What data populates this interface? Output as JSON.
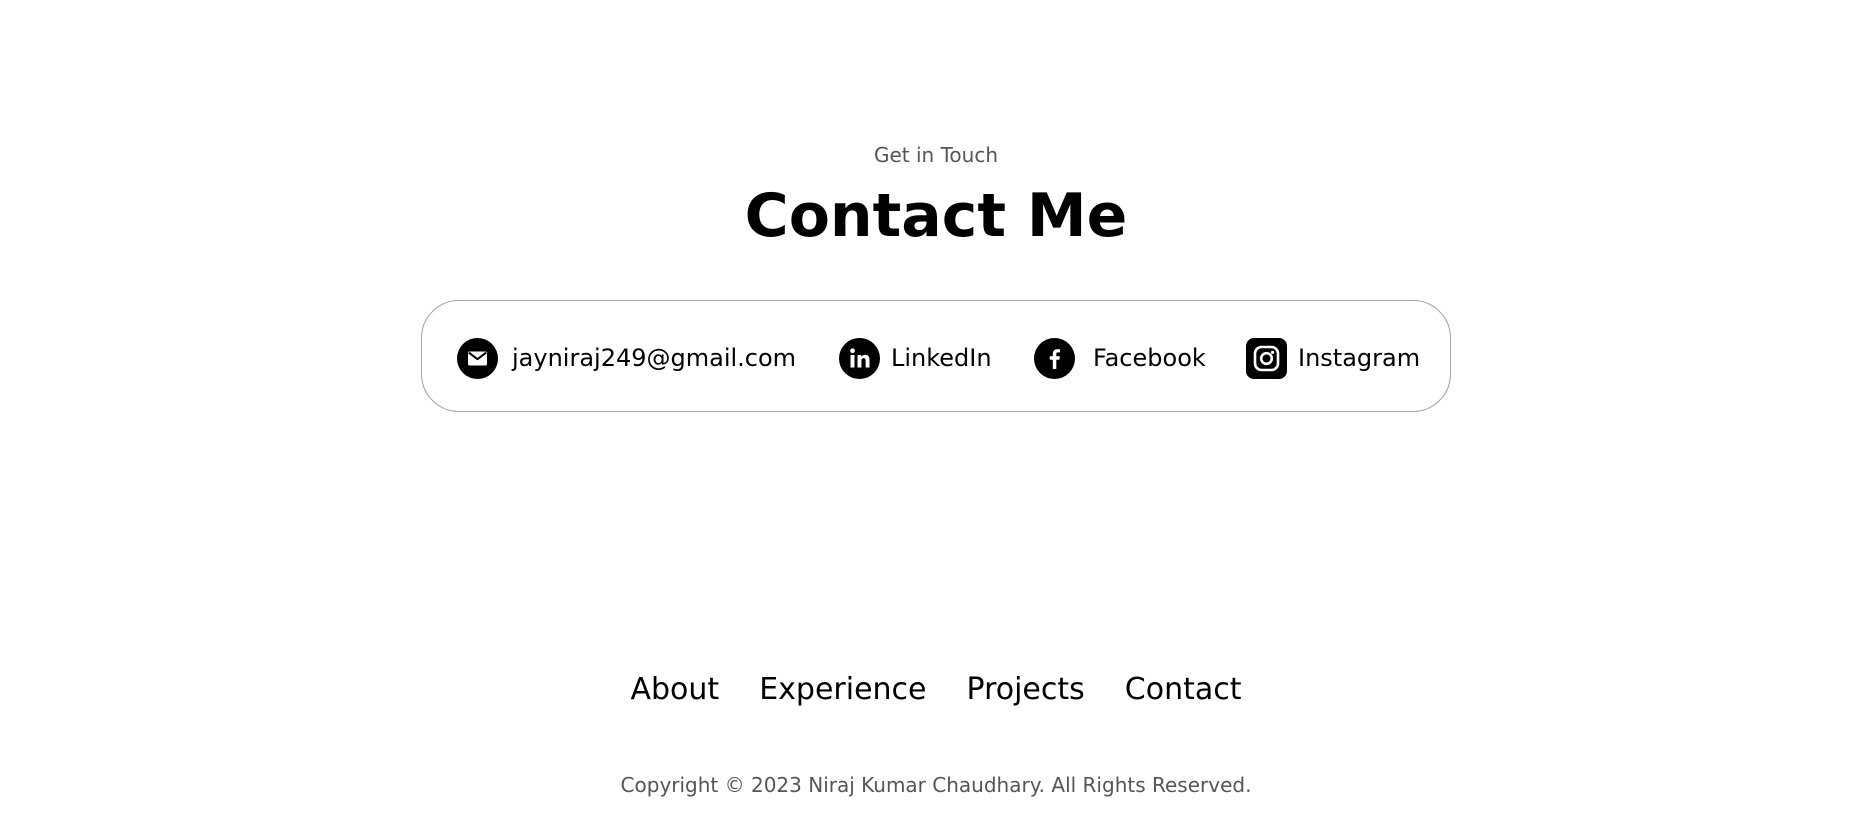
{
  "header": {
    "subtitle": "Get in Touch",
    "title": "Contact Me"
  },
  "contacts": [
    {
      "label": "jayniraj249@gmail.com",
      "icon": "email-icon"
    },
    {
      "label": "LinkedIn",
      "icon": "linkedin-icon"
    },
    {
      "label": "Facebook",
      "icon": "facebook-icon"
    },
    {
      "label": "Instagram",
      "icon": "instagram-icon"
    }
  ],
  "footer": {
    "nav": [
      "About",
      "Experience",
      "Projects",
      "Contact"
    ],
    "copyright": "Copyright © 2023 Niraj Kumar Chaudhary. All Rights Reserved."
  },
  "colors": {
    "text": "#000000",
    "muted": "#555555",
    "border": "#a3a3a3",
    "background": "#ffffff"
  }
}
